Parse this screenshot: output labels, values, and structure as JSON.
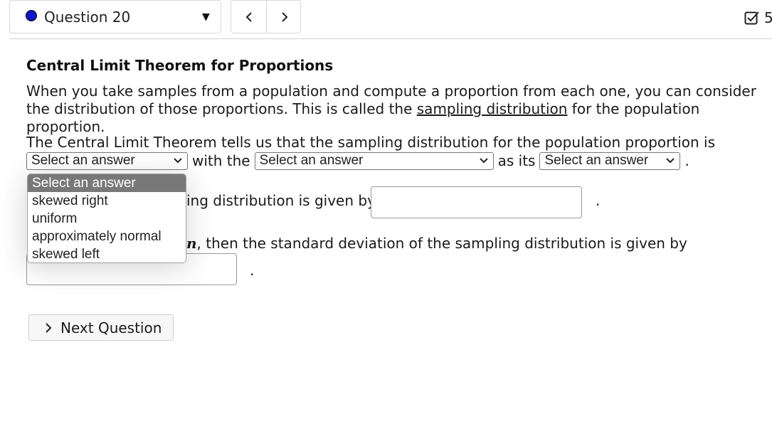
{
  "header": {
    "question_label": "Question 20",
    "check_count": "5"
  },
  "content": {
    "title": "Central Limit Theorem for Proportions",
    "para1_a": "When you take samples from a population and compute a proportion from each one, you can consider the distribution of those proportions. This is called the ",
    "para1_link": "sampling distribution",
    "para1_b": " for the population proportion.",
    "sentence2": "The Central Limit Theorem tells us that the sampling distribution for the population proportion is",
    "with_the": "with the",
    "as_its": "as its",
    "period": ".",
    "line3_visible": "ing distribution is given by",
    "line4_var": "n",
    "line4_visible": ", then the standard deviation of the sampling distribution is given by"
  },
  "selects": {
    "shape": "Select an answer",
    "center": "Select an answer",
    "spread": "Select an answer"
  },
  "dropdown": {
    "options": [
      "Select an answer",
      "skewed right",
      "uniform",
      "approximately normal",
      "skewed left"
    ],
    "selected_index": 0
  },
  "buttons": {
    "next_question": "Next Question"
  },
  "colors": {
    "question_dot": "#1016c8",
    "selected_option_bg": "#787878"
  }
}
